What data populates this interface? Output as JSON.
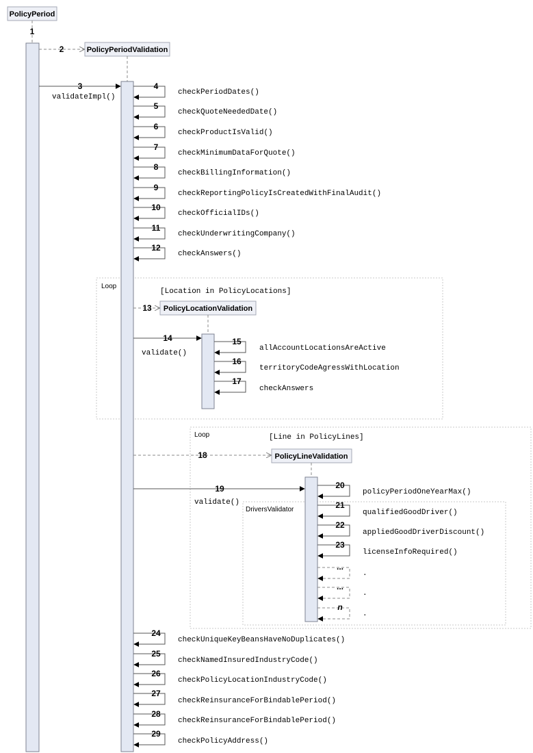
{
  "participants": {
    "policy_period": "PolicyPeriod",
    "policy_period_validation": "PolicyPeriodValidation",
    "policy_location_validation": "PolicyLocationValidation",
    "policy_line_validation": "PolicyLineValidation"
  },
  "loops": [
    {
      "label": "Loop",
      "guard": "[Location in PolicyLocations]"
    },
    {
      "label": "Loop",
      "guard": "[Line in PolicyLines]"
    }
  ],
  "group": {
    "label": "DriversValidator"
  },
  "messages": [
    {
      "num": "1",
      "label": ""
    },
    {
      "num": "2",
      "label": ""
    },
    {
      "num": "3",
      "label": "validateImpl()"
    },
    {
      "num": "4",
      "label": "checkPeriodDates()"
    },
    {
      "num": "5",
      "label": "checkQuoteNeededDate()"
    },
    {
      "num": "6",
      "label": "checkProductIsValid()"
    },
    {
      "num": "7",
      "label": "checkMinimumDataForQuote()"
    },
    {
      "num": "8",
      "label": "checkBillingInformation()"
    },
    {
      "num": "9",
      "label": "checkReportingPolicyIsCreatedWithFinalAudit()"
    },
    {
      "num": "10",
      "label": "checkOfficialIDs()"
    },
    {
      "num": "11",
      "label": "checkUnderwritingCompany()"
    },
    {
      "num": "12",
      "label": "checkAnswers()"
    },
    {
      "num": "13",
      "label": ""
    },
    {
      "num": "14",
      "label": "validate()"
    },
    {
      "num": "15",
      "label": "allAccountLocationsAreActive"
    },
    {
      "num": "16",
      "label": "territoryCodeAgressWithLocation"
    },
    {
      "num": "17",
      "label": "checkAnswers"
    },
    {
      "num": "18",
      "label": ""
    },
    {
      "num": "19",
      "label": "validate()"
    },
    {
      "num": "20",
      "label": "policyPeriodOneYearMax()"
    },
    {
      "num": "21",
      "label": "qualifiedGoodDriver()"
    },
    {
      "num": "22",
      "label": "appliedGoodDriverDiscount()"
    },
    {
      "num": "23",
      "label": "licenseInfoRequired()"
    },
    {
      "num": "...",
      "label": "."
    },
    {
      "num": "...",
      "label": "."
    },
    {
      "num": "n",
      "label": "."
    },
    {
      "num": "24",
      "label": "checkUniqueKeyBeansHaveNoDuplicates()"
    },
    {
      "num": "25",
      "label": "checkNamedInsuredIndustryCode()"
    },
    {
      "num": "26",
      "label": "checkPolicyLocationIndustryCode()"
    },
    {
      "num": "27",
      "label": "checkReinsuranceForBindablePeriod()"
    },
    {
      "num": "28",
      "label": "checkReinsuranceForBindablePeriod()"
    },
    {
      "num": "29",
      "label": "checkPolicyAddress()"
    }
  ]
}
